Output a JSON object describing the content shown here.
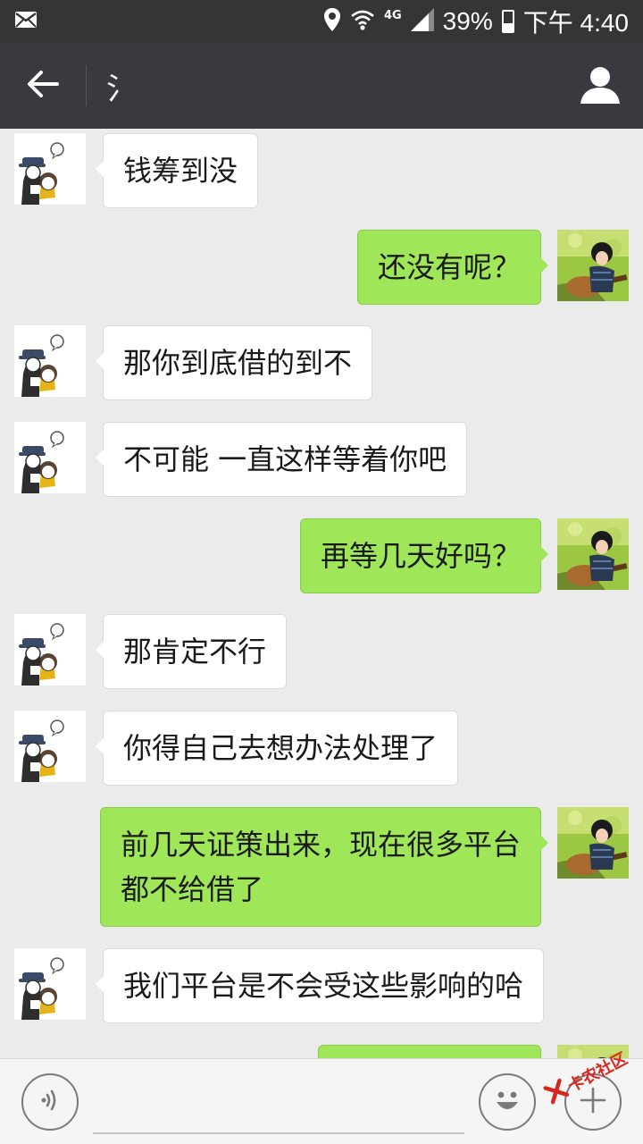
{
  "status_bar": {
    "icons": [
      "mail-icon",
      "location-icon",
      "wifi-icon",
      "signal-icon",
      "battery-icon"
    ],
    "network": "4G",
    "battery_percent": "39%",
    "battery_level": 0.39,
    "time": "下午 4:40"
  },
  "header": {
    "back_icon": "arrow-left-icon",
    "title": "氵",
    "profile_icon": "person-icon"
  },
  "messages": [
    {
      "side": "left",
      "text": "钱筹到没"
    },
    {
      "side": "right",
      "text": "还没有呢？"
    },
    {
      "side": "left",
      "text": "那你到底借的到不"
    },
    {
      "side": "left",
      "text": "不可能 一直这样等着你吧"
    },
    {
      "side": "right",
      "text": "再等几天好吗？"
    },
    {
      "side": "left",
      "text": "那肯定不行"
    },
    {
      "side": "left",
      "text": "你得自己去想办法处理了"
    },
    {
      "side": "right",
      "text": "前几天证策出来，现在很多平台\n都不给借了"
    },
    {
      "side": "left",
      "text": "我们平台是不会受这些影响的哈"
    },
    {
      "side": "right",
      "text": ""
    }
  ],
  "input_bar": {
    "voice_icon": "voice-icon",
    "text_value": "",
    "emoji_icon": "smiley-icon",
    "plus_icon": "plus-icon"
  },
  "watermark": {
    "text": "卡农社区"
  },
  "colors": {
    "sent_bubble": "#9fe659",
    "received_bubble": "#ffffff",
    "header_bg": "#393a3f",
    "status_bg": "#353535",
    "chat_bg": "#ebebeb"
  }
}
